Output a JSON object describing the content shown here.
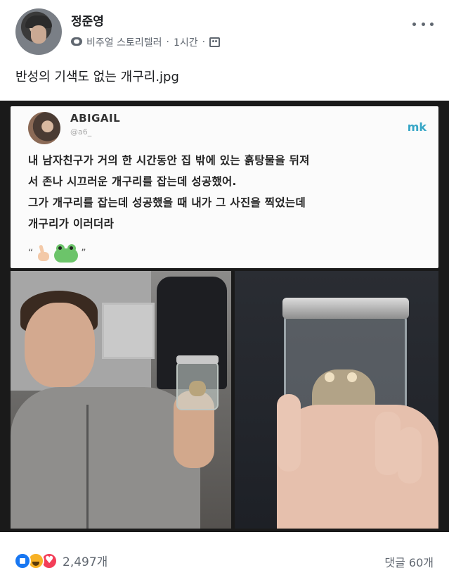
{
  "post": {
    "author": "정준영",
    "badge": "비주얼 스토리텔러",
    "time": "1시간",
    "separator": "·",
    "caption": "반성의 기색도 없는 개구리.jpg"
  },
  "image": {
    "tweet": {
      "name": "ABIGAIL",
      "handle": "@a6_",
      "source_mark": "mk",
      "lines": [
        "내 남자친구가 거의 한 시간동안 집 밖에 있는 흙탕물을 뒤져",
        "서 존나 시끄러운 개구리를 잡는데 성공했어.",
        "그가 개구리를 잡는데 성공했을 때 내가 그 사진을 찍었는데",
        "개구리가 이러더라"
      ],
      "open_quote": "“",
      "close_quote": "”"
    }
  },
  "footer": {
    "reaction_count": "2,497개",
    "comments": "댓글 60개"
  },
  "icons": {
    "badge": "visual-storyteller-icon",
    "audience": "friends-audience-icon",
    "more": "more-options-icon",
    "reactions": [
      "like-icon",
      "haha-icon",
      "love-icon"
    ]
  },
  "colors": {
    "like": "#1877f2",
    "haha": "#f7b125",
    "love": "#f33e58",
    "mk": "#36a6c6"
  }
}
